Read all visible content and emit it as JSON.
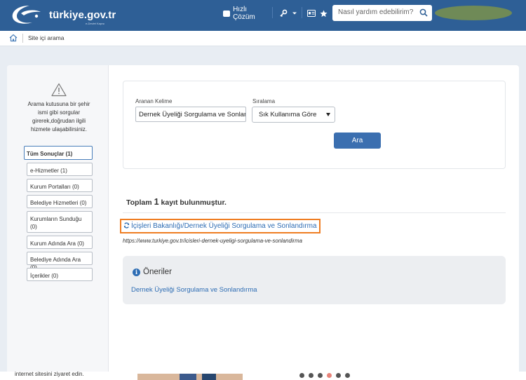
{
  "header": {
    "logo_text": "türkiye.gov.tr",
    "logo_subtext": "e-Devlet Kapısı",
    "quick_solution_label": "Hızlı Çözüm",
    "search_placeholder": "Nasıl yardım edebilirim?"
  },
  "breadcrumb": {
    "current": "Site içi arama"
  },
  "sidebar": {
    "info_text": "Arama kutusuna bir şehir ismi gibi sorgular girerek,doğrudan ilgili hizmete ulaşabilirsiniz.",
    "filters": [
      {
        "label": "Tüm Sonuçlar (1)",
        "active": true
      },
      {
        "label": "e-Hizmetler (1)",
        "active": false
      },
      {
        "label": "Kurum Portalları (0)",
        "active": false
      },
      {
        "label": "Belediye Hizmetleri (0)",
        "active": false
      },
      {
        "label": "Kurumların Sunduğu (0)",
        "active": false
      },
      {
        "label": "Kurum Adında Ara (0)",
        "active": false
      },
      {
        "label": "Belediye Adında Ara (0)",
        "active": false
      },
      {
        "label": "İçerikler (0)",
        "active": false
      }
    ]
  },
  "search_form": {
    "keyword_label": "Aranan Kelime",
    "keyword_value": "Dernek Üyeliği Sorgulama ve Sonlandırma",
    "sort_label": "Sıralama",
    "sort_value": "Sık Kullanıma Göre",
    "submit_label": "Ara"
  },
  "results": {
    "total_prefix": "Toplam",
    "total_count": "1",
    "total_suffix": "kayıt bulunmuştur.",
    "items": [
      {
        "title": "İçişleri Bakanlığı/Dernek Üyeliği Sorgulama ve Sonlandırma",
        "url": "https://www.turkiye.gov.tr/icisleri-dernek-uyeligi-sorgulama-ve-sonlandirma"
      }
    ]
  },
  "suggestions": {
    "title": "Öneriler",
    "items": [
      "Dernek Üyeliği Sorgulama ve Sonlandırma"
    ]
  },
  "footer_partial": {
    "text": "internet sitesini ziyaret edin."
  },
  "colors": {
    "header_bg": "#2e5f96",
    "link": "#2e6db4",
    "button": "#3b6fb0",
    "highlight": "#ef7d22"
  }
}
